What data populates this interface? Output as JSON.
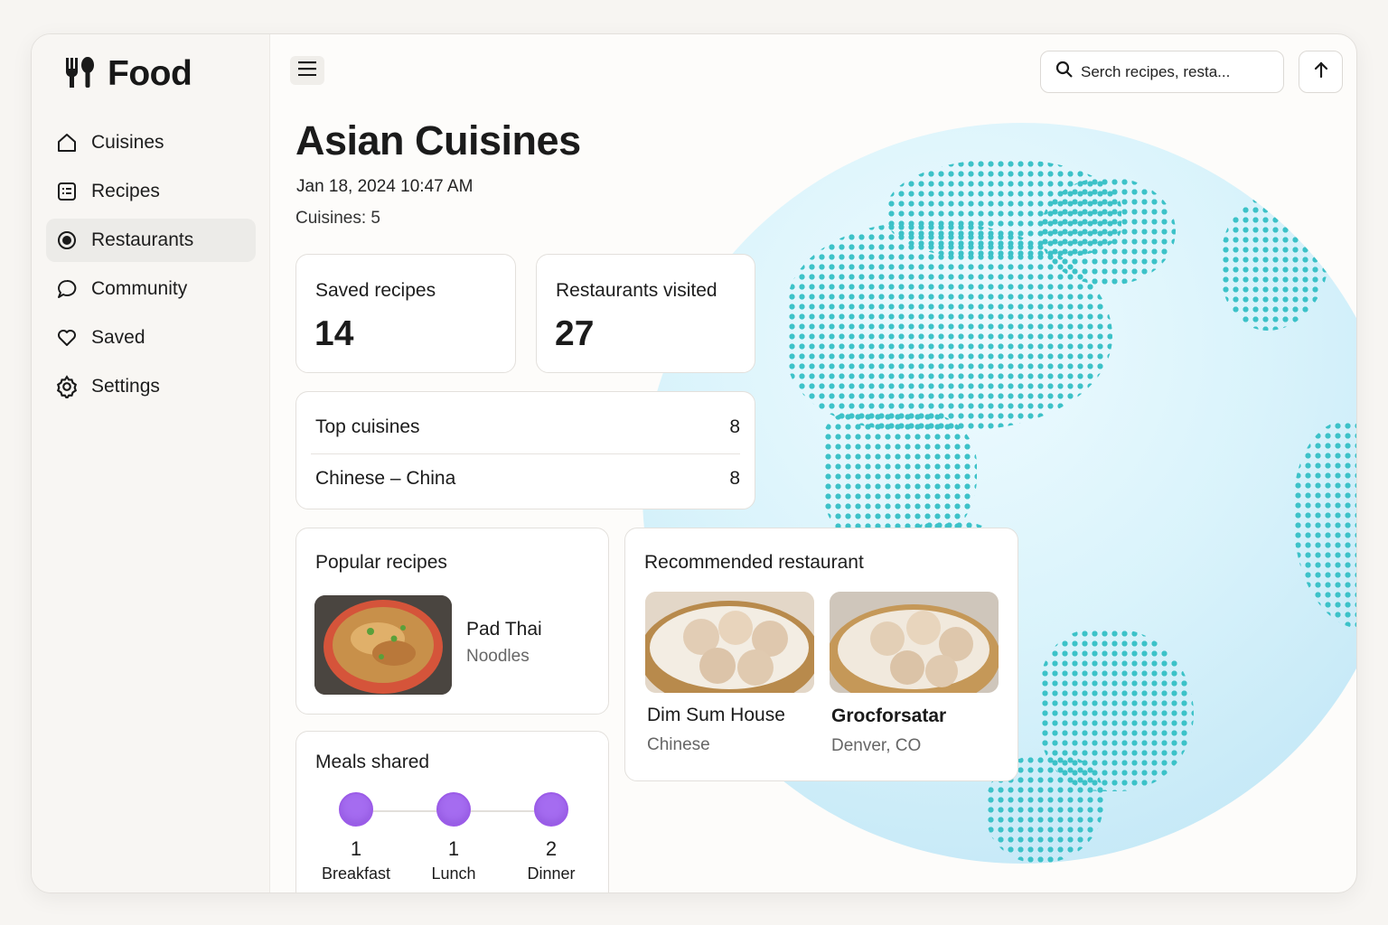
{
  "app": {
    "title": "Food",
    "logo_icon": "fork-spoon-icon"
  },
  "sidebar": {
    "items": [
      {
        "label": "Cuisines",
        "icon": "home-icon",
        "active": false
      },
      {
        "label": "Recipes",
        "icon": "recipe-card-icon",
        "active": false
      },
      {
        "label": "Restaurants",
        "icon": "location-pin-icon",
        "active": true
      },
      {
        "label": "Community",
        "icon": "chat-bubble-icon",
        "active": false
      },
      {
        "label": "Saved",
        "icon": "heart-icon",
        "active": false
      },
      {
        "label": "Settings",
        "icon": "gear-icon",
        "active": false
      }
    ]
  },
  "header": {
    "search_placeholder": "Serch recipes, resta...",
    "menu_icon": "hamburger-icon",
    "upload_icon": "arrow-up-icon"
  },
  "main": {
    "title": "Asian Cuisines",
    "datetime": "Jan 18, 2024 10:47 AM",
    "cuisines_count": "Cuisines: 5",
    "stats": {
      "saved_recipes": {
        "label": "Saved recipes",
        "value": "14"
      },
      "restaurants_visited": {
        "label": "Restaurants visited",
        "value": "27"
      }
    },
    "top_cuisines": {
      "header_label": "Top cuisines",
      "header_value": "8",
      "rows": [
        {
          "label": "Chinese – China",
          "value": "8"
        }
      ]
    },
    "popular_recipes": {
      "label": "Popular recipes",
      "item": {
        "name": "Pad Thai",
        "category": "Noodles"
      }
    },
    "recommended": {
      "label": "Recommended restaurant",
      "items": [
        {
          "name": "Dim Sum House",
          "sub": "Chinese"
        },
        {
          "name": "Grocforsatar",
          "sub": "Denver, CO"
        }
      ]
    },
    "meals_shared": {
      "label": "Meals shared",
      "items": [
        {
          "count": "1",
          "label": "Breakfast"
        },
        {
          "count": "1",
          "label": "Lunch"
        },
        {
          "count": "2",
          "label": "Dinner"
        }
      ]
    }
  },
  "colors": {
    "accent_purple": "#a56cf0",
    "globe_dots": "#3cc2c8",
    "globe_bg": "#d9f3fb"
  }
}
